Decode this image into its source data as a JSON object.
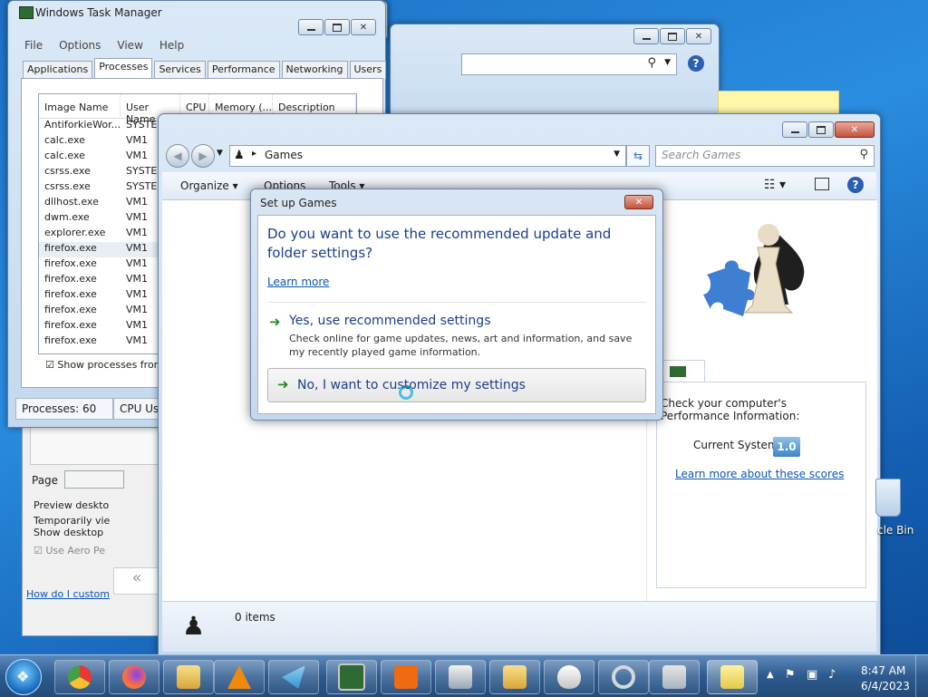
{
  "task_manager": {
    "title": "Windows Task Manager",
    "menu": [
      "File",
      "Options",
      "View",
      "Help"
    ],
    "tabs": [
      "Applications",
      "Processes",
      "Services",
      "Performance",
      "Networking",
      "Users"
    ],
    "columns": [
      "Image Name",
      "User Name",
      "CPU",
      "Memory (...",
      "Description"
    ],
    "processes": [
      {
        "name": "AntiforkieWor...",
        "user": "SYSTEM"
      },
      {
        "name": "calc.exe",
        "user": "VM1"
      },
      {
        "name": "calc.exe",
        "user": "VM1"
      },
      {
        "name": "csrss.exe",
        "user": "SYSTEM"
      },
      {
        "name": "csrss.exe",
        "user": "SYSTEM"
      },
      {
        "name": "dllhost.exe",
        "user": "VM1"
      },
      {
        "name": "dwm.exe",
        "user": "VM1"
      },
      {
        "name": "explorer.exe",
        "user": "VM1"
      },
      {
        "name": "firefox.exe",
        "user": "VM1"
      },
      {
        "name": "firefox.exe",
        "user": "VM1"
      },
      {
        "name": "firefox.exe",
        "user": "VM1"
      },
      {
        "name": "firefox.exe",
        "user": "VM1"
      },
      {
        "name": "firefox.exe",
        "user": "VM1"
      },
      {
        "name": "firefox.exe",
        "user": "VM1"
      },
      {
        "name": "firefox.exe",
        "user": "VM1"
      }
    ],
    "show_all_label": "Show processes from all",
    "status_processes": "Processes: 60",
    "status_cpu": "CPU Usa"
  },
  "perf_options": {
    "page_label": "Page",
    "preview": "Preview deskto",
    "temporarily": "Temporarily vie",
    "show_desktop": "Show desktop",
    "use_aero": "Use Aero Pe",
    "link": "How do I custom"
  },
  "games": {
    "address": "Games",
    "search_placeholder": "Search Games",
    "cmd": {
      "organize": "Organize",
      "options": "Options",
      "tools": "Tools"
    },
    "items_count": "0 items",
    "perf_info": "Check your computer's Performance Information:",
    "current_system": "Current System",
    "score": "1.0",
    "learn_scores": "Learn more about these scores"
  },
  "dialog": {
    "title": "Set up Games",
    "question": "Do you want to use the recommended update and folder settings?",
    "learn_more": "Learn more",
    "opt1_title": "Yes, use recommended settings",
    "opt1_desc": "Check online for game updates, news, art and information, and save my recently played game information.",
    "opt2_title": "No, I want to customize my settings"
  },
  "desktop": {
    "recycle_bin": "cle Bin"
  },
  "taskbar": {
    "time": "8:47 AM",
    "date": "6/4/2023"
  },
  "colors": {
    "accent": "#0b55b8",
    "taskbar": "#2d5a8e",
    "note": "#fff7a8"
  }
}
